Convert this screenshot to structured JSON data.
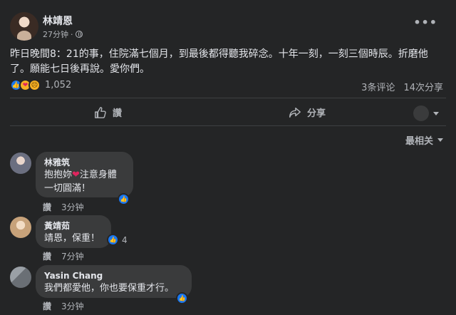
{
  "post": {
    "author": "林靖恩",
    "time": "27分钟",
    "text": "昨日晚間8：21的事，住院滿七個月，到最後都得聽我碎念。十年一刻，一刻三個時辰。折磨他了。願能七日後再說。愛你們。",
    "reaction_count": "1,052",
    "comments_count": "3条评论",
    "shares_count": "14次分享",
    "more_symbol": "•••"
  },
  "actions": {
    "like_label": "讚",
    "share_label": "分享"
  },
  "sort": {
    "label": "最相关"
  },
  "comments": [
    {
      "name": "林雅筑",
      "text_before": "抱抱妳",
      "heart": "❤",
      "text_after": "注意身體",
      "line2": "一切圓滿！",
      "like_label": "讚",
      "time": "3分钟"
    },
    {
      "name": "黃靖茹",
      "text": "靖恩，保重！",
      "reaction_count": "4",
      "like_label": "讚",
      "time": "7分钟"
    },
    {
      "name": "Yasin Chang",
      "text": "我們都愛他，你也要保重才行。",
      "like_label": "讚",
      "time": "3分钟"
    }
  ],
  "colors": {
    "background": "#242526",
    "bubble": "#3a3b3c",
    "secondary_text": "#b0b3b8",
    "like_blue": "#1877f2"
  }
}
